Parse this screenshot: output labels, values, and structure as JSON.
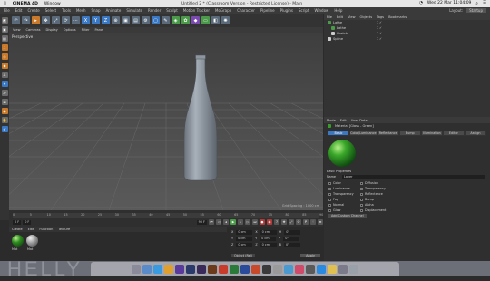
{
  "mac_menu": {
    "apple": "",
    "app": "CINEMA 4D",
    "window": "Window",
    "title": "Untitled 2 * (Classroom Version - Restricted License) - Main",
    "clock": "Wed 22 Mar  11:04:09"
  },
  "c4d_menu": [
    "File",
    "Edit",
    "Create",
    "Select",
    "Tools",
    "Mesh",
    "Snap",
    "Animate",
    "Simulate",
    "Render",
    "Sculpt",
    "Motion Tracker",
    "MoGraph",
    "Character",
    "Pipeline",
    "Plugins",
    "Script",
    "Window",
    "Help"
  ],
  "layout": {
    "label": "Layout:",
    "value": "Startup"
  },
  "view_menu": [
    "View",
    "Cameras",
    "Display",
    "Options",
    "Filter",
    "Panel"
  ],
  "viewport": {
    "label": "Perspective",
    "grid_spacing": "Grid Spacing : 1000 cm"
  },
  "object_manager": {
    "tabs": [
      "File",
      "Edit",
      "View",
      "Objects",
      "Tags",
      "Bookmarks"
    ],
    "objects": [
      {
        "name": "Lathe",
        "color": "#4a9a4a"
      },
      {
        "name": "Lathe",
        "color": "#4a9a4a"
      },
      {
        "name": "Sketch",
        "color": "#cccccc"
      },
      {
        "name": "Spline",
        "color": "#cccccc"
      }
    ]
  },
  "attribute_manager": {
    "tabs": [
      "Mode",
      "Edit",
      "User Data"
    ],
    "material_title": "Material [Glass - Green]",
    "channel_tabs": [
      "Basic",
      "Color/Luminance",
      "Reflectance",
      "Bump",
      "Illumination",
      "Editor",
      "Assign"
    ],
    "basic_properties": "Basic Properties",
    "name_label": "Name",
    "name_value": "Layer",
    "checks_left": [
      "Color",
      "Luminance",
      "Transparency",
      "Fog",
      "Normal",
      "Glow"
    ],
    "checks_right": [
      "Diffusion",
      "Transparency",
      "Reflectance",
      "Bump",
      "Alpha",
      "Displacement"
    ],
    "add_button": "Add Custom Channel"
  },
  "timeline": {
    "ticks": [
      "0",
      "5",
      "10",
      "15",
      "20",
      "25",
      "30",
      "35",
      "40",
      "45",
      "50",
      "55",
      "60",
      "65",
      "70",
      "75",
      "80",
      "85",
      "90"
    ],
    "start": "0 F",
    "end": "90 F",
    "current": "0 F"
  },
  "material_panel": {
    "menu": [
      "Create",
      "Edit",
      "Function",
      "Texture"
    ],
    "materials": [
      "Mat",
      "Mat"
    ]
  },
  "coords": {
    "rows": [
      {
        "a": "X",
        "av": "0 cm",
        "b": "X",
        "bv": "0 cm",
        "c": "H",
        "cv": "0°"
      },
      {
        "a": "Y",
        "av": "0 cm",
        "b": "Y",
        "bv": "0 cm",
        "c": "P",
        "cv": "0°"
      },
      {
        "a": "Z",
        "av": "0 cm",
        "b": "Z",
        "bv": "0 cm",
        "c": "B",
        "cv": "0°"
      }
    ],
    "mode": "Object (Rel)",
    "apply": "Apply"
  },
  "wallpaper_text": "HELLY"
}
